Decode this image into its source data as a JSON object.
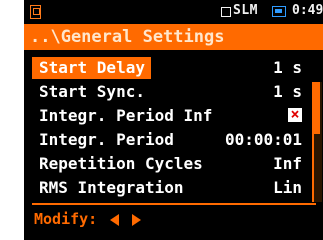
{
  "status_bar": {
    "mode": "SLM",
    "time": "0:49",
    "icons": [
      "menu-icon",
      "mode-indicator-icon",
      "battery-icon"
    ]
  },
  "header": {
    "title": "..\\General Settings"
  },
  "settings": {
    "items": [
      {
        "label": "Start Delay",
        "value": "1 s",
        "selected": true
      },
      {
        "label": "Start Sync.",
        "value": "1 s"
      },
      {
        "label": "Integr. Period Inf",
        "value": "×"
      },
      {
        "label": "Integr. Period",
        "value": "00:00:01"
      },
      {
        "label": "Repetition Cycles",
        "value": "Inf"
      },
      {
        "label": "RMS Integration",
        "value": "Lin"
      }
    ]
  },
  "footer": {
    "hint": "Modify:"
  },
  "colors": {
    "accent": "#ff6a00",
    "background": "#000000",
    "text": "#ffffff",
    "battery": "#2e9bff",
    "checkbox_x": "#e00000"
  }
}
